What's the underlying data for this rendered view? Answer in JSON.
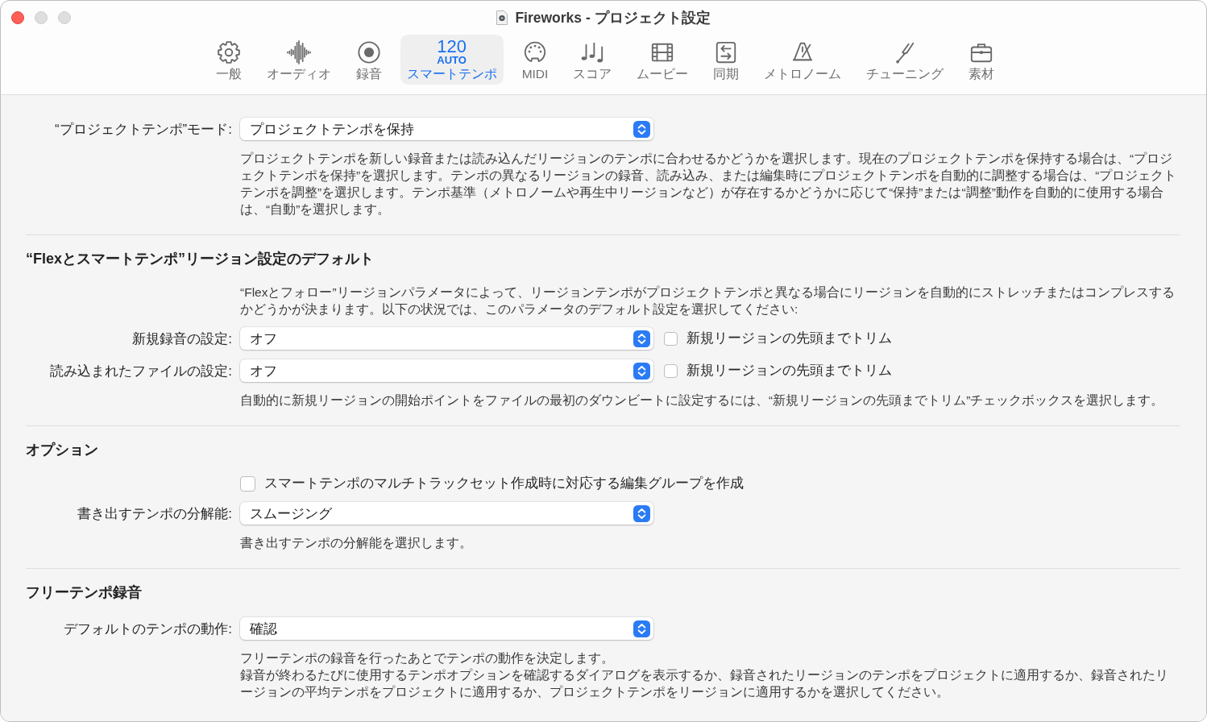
{
  "window": {
    "title": "Fireworks - プロジェクト設定",
    "buttons": [
      {
        "kind": "close",
        "disabled": false
      },
      {
        "kind": "minimize",
        "disabled": true
      },
      {
        "kind": "zoom",
        "disabled": true
      }
    ]
  },
  "toolbar": [
    {
      "kind": "icon",
      "label": "一般",
      "selected": false
    },
    {
      "kind": "icon",
      "label": "オーディオ",
      "selected": false
    },
    {
      "kind": "icon",
      "label": "録音",
      "selected": false
    },
    {
      "kind": "tempo",
      "tempo": "120",
      "mode": "AUTO",
      "label": "スマートテンポ",
      "selected": true
    },
    {
      "kind": "icon",
      "label": "MIDI",
      "selected": false
    },
    {
      "kind": "icon",
      "label": "スコア",
      "selected": false
    },
    {
      "kind": "icon",
      "label": "ムービー",
      "selected": false
    },
    {
      "kind": "icon",
      "label": "同期",
      "selected": false
    },
    {
      "kind": "icon",
      "label": "メトロノーム",
      "selected": false
    },
    {
      "kind": "icon",
      "label": "チューニング",
      "selected": false
    },
    {
      "kind": "icon",
      "label": "素材",
      "selected": false
    }
  ],
  "sections": [
    {
      "items": [
        {
          "kind": "popup",
          "label": "“プロジェクトテンポ”モード:",
          "value": "プロジェクトテンポを保持"
        },
        {
          "kind": "note",
          "text": "プロジェクトテンポを新しい録音または読み込んだリージョンのテンポに合わせるかどうかを選択します。現在のプロジェクトテンポを保持する場合は、“プロジェクトテンポを保持”を選択します。テンポの異なるリージョンの録音、読み込み、または編集時にプロジェクトテンポを自動的に調整する場合は、“プロジェクトテンポを調整”を選択します。テンポ基準（メトロノームや再生中リージョンなど）が存在するかどうかに応じて“保持”または“調整”動作を自動的に使用する場合は、“自動”を選択します。"
        }
      ]
    },
    {
      "heading": "“Flexとスマートテンポ”リージョン設定のデフォルト",
      "items": [
        {
          "kind": "note",
          "text": "“Flexとフォロー”リージョンパラメータによって、リージョンテンポがプロジェクトテンポと異なる場合にリージョンを自動的にストレッチまたはコンプレスするかどうかが決まります。以下の状況では、このパラメータのデフォルト設定を選択してください:"
        },
        {
          "kind": "popup",
          "label": "新規録音の設定:",
          "value": "オフ",
          "checkbox": {
            "label": "新規リージョンの先頭までトリム",
            "checked": false
          }
        },
        {
          "kind": "popup",
          "label": "読み込まれたファイルの設定:",
          "value": "オフ",
          "checkbox": {
            "label": "新規リージョンの先頭までトリム",
            "checked": false
          }
        },
        {
          "kind": "note",
          "text": "自動的に新規リージョンの開始ポイントをファイルの最初のダウンビートに設定するには、“新規リージョンの先頭までトリム”チェックボックスを選択します。"
        }
      ]
    },
    {
      "heading": "オプション",
      "items": [
        {
          "kind": "checkbox",
          "label": "スマートテンポのマルチトラックセット作成時に対応する編集グループを作成",
          "checked": false
        },
        {
          "kind": "popup",
          "label": "書き出すテンポの分解能:",
          "value": "スムージング"
        },
        {
          "kind": "note",
          "text": "書き出すテンポの分解能を選択します。"
        }
      ]
    },
    {
      "heading": "フリーテンポ録音",
      "items": [
        {
          "kind": "popup",
          "label": "デフォルトのテンポの動作:",
          "value": "確認"
        },
        {
          "kind": "note",
          "text": "フリーテンポの録音を行ったあとでテンポの動作を決定します。"
        },
        {
          "kind": "note",
          "text": "録音が終わるたびに使用するテンポオプションを確認するダイアログを表示するか、録音されたリージョンのテンポをプロジェクトに適用するか、録音されたリージョンの平均テンポをプロジェクトに適用するか、プロジェクトテンポをリージョンに適用するかを選択してください。"
        }
      ]
    }
  ]
}
